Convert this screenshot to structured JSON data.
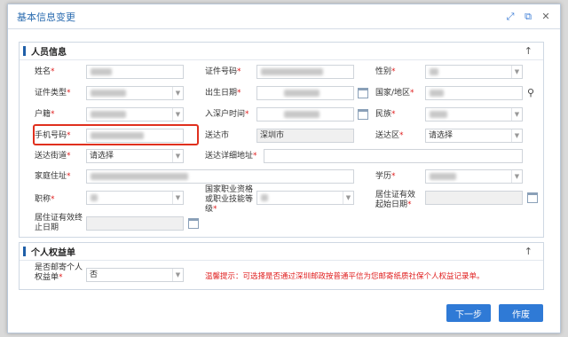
{
  "dialog": {
    "title": "基本信息变更"
  },
  "personal": {
    "title": "人员信息",
    "labels": {
      "name": "姓名",
      "id_no": "证件号码",
      "gender": "性别",
      "id_type": "证件类型",
      "birth": "出生日期",
      "country": "国家/地区",
      "hukou": "户籍",
      "arrive_date": "入深户时间",
      "ethnic": "民族",
      "phone": "手机号码",
      "send_city": "送达市",
      "send_district": "送达区",
      "send_street": "送达街道",
      "send_address": "送达详细地址",
      "home_address": "家庭住址",
      "education": "学历",
      "title_rank": "职称",
      "qualification": "国家职业资格或职业技能等级",
      "permit_start": "居住证有效起始日期",
      "permit_end": "居住证有效终止日期"
    },
    "values": {
      "send_city": "深圳市",
      "send_district": "请选择",
      "send_street": "请选择"
    }
  },
  "rights": {
    "title": "个人权益单",
    "label": "是否邮寄个人权益单",
    "value": "否",
    "tip": "温馨提示：可选择是否通过深圳邮政按普通平信为您邮寄纸质社保个人权益记录单。"
  },
  "buttons": {
    "next": "下一步",
    "cancel": "作废"
  }
}
